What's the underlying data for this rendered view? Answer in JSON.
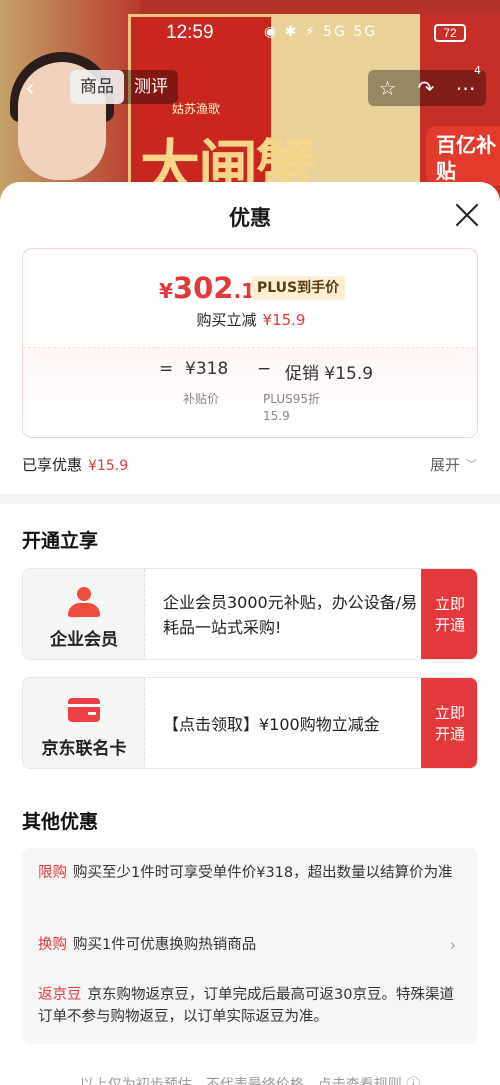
{
  "status_bar": {
    "time": "12:59",
    "icons": "◉ ✱ ⚡ 5G 5G",
    "battery": "72"
  },
  "nav": {
    "back_icon": "chevron-left-icon",
    "tabs": [
      {
        "label": "商品",
        "active": true
      },
      {
        "label": "测评",
        "active": false
      }
    ],
    "actions": [
      "star-icon",
      "share-icon",
      "more-icon"
    ],
    "badge": "4"
  },
  "product_bg": {
    "brand": "姑苏渔歌",
    "big_text": "大闸蟹",
    "subsidy": "百亿补贴"
  },
  "sheet": {
    "title": "优惠",
    "price_card": {
      "currency": "¥",
      "price_int": "302",
      "price_dec": ".1",
      "plus_tag": "PLUS到手价",
      "discount_label": "购买立减",
      "discount_value": "¥15.9",
      "formula": {
        "equals": "=",
        "base_price": "¥318",
        "minus": "−",
        "promo": "促销 ¥15.9",
        "base_label": "补贴价",
        "promo_label_line1": "PLUS95折",
        "promo_label_line2": "15.9"
      }
    },
    "enjoyed": {
      "label": "已享优惠",
      "value": "¥15.9",
      "expand": "展开"
    },
    "open_section": {
      "title": "开通立享",
      "cards": [
        {
          "icon": "person-icon",
          "label": "企业会员",
          "desc": "企业会员3000元补贴，办公设备/易耗品一站式采购!",
          "button_line1": "立即",
          "button_line2": "开通"
        },
        {
          "icon": "credit-card-icon",
          "label": "京东联名卡",
          "desc": "【点击领取】¥100购物立减金",
          "button_line1": "立即",
          "button_line2": "开通"
        }
      ]
    },
    "other_section": {
      "title": "其他优惠",
      "rows": [
        {
          "tag": "限购",
          "text": "购买至少1件时可享受单件价¥318，超出数量以结算价为准"
        },
        {
          "tag": "换购",
          "text": "购买1件可优惠换购热销商品"
        },
        {
          "tag": "返京豆",
          "text": "京东购物返京豆，订单完成后最高可返30京豆。特殊渠道订单不参与购物返豆，以订单实际返豆为准。"
        }
      ]
    },
    "footer_note": "以上仅为初步预估，不代表最终价格，点击查看规则 ⓘ"
  },
  "colors": {
    "accent_red": "#e4393c",
    "plus_tag_bg": "#fcefd3",
    "plus_tag_text": "#5b3b14"
  }
}
